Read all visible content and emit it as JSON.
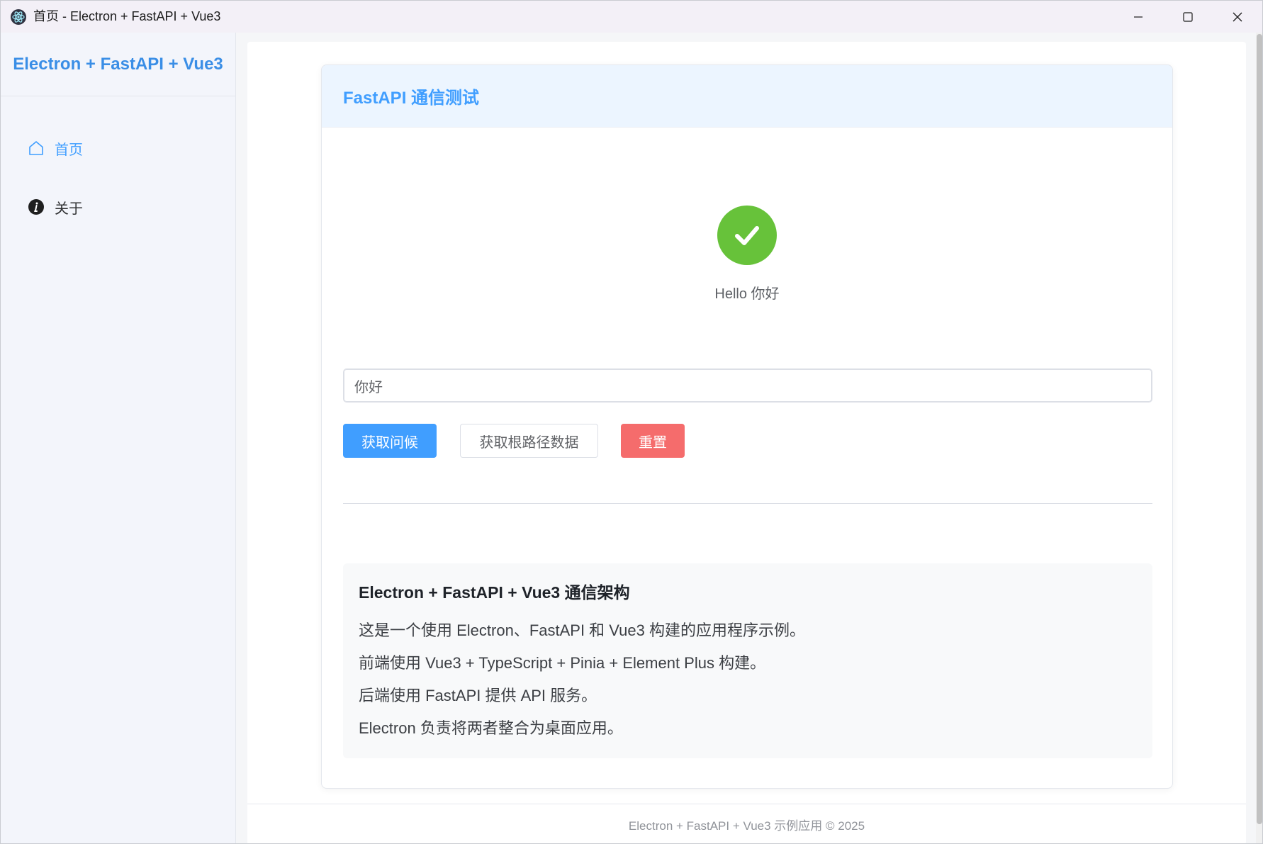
{
  "window": {
    "title": "首页 - Electron + FastAPI + Vue3"
  },
  "sidebar": {
    "brand": "Electron + FastAPI + Vue3",
    "items": [
      {
        "label": "首页",
        "icon": "home-icon",
        "active": true
      },
      {
        "label": "关于",
        "icon": "info-icon",
        "active": false
      }
    ]
  },
  "card": {
    "header": "FastAPI 通信测试",
    "result_text": "Hello 你好",
    "input_value": "你好",
    "buttons": {
      "greet": "获取问候",
      "root": "获取根路径数据",
      "reset": "重置"
    }
  },
  "info": {
    "title": "Electron + FastAPI + Vue3 通信架构",
    "lines": [
      "这是一个使用 Electron、FastAPI 和 Vue3 构建的应用程序示例。",
      "前端使用 Vue3 + TypeScript + Pinia + Element Plus 构建。",
      "后端使用 FastAPI 提供 API 服务。",
      "Electron 负责将两者整合为桌面应用。"
    ]
  },
  "footer": {
    "text": "Electron + FastAPI + Vue3 示例应用 © 2025"
  },
  "colors": {
    "primary": "#409eff",
    "success": "#67c23a",
    "danger": "#f56c6c"
  }
}
